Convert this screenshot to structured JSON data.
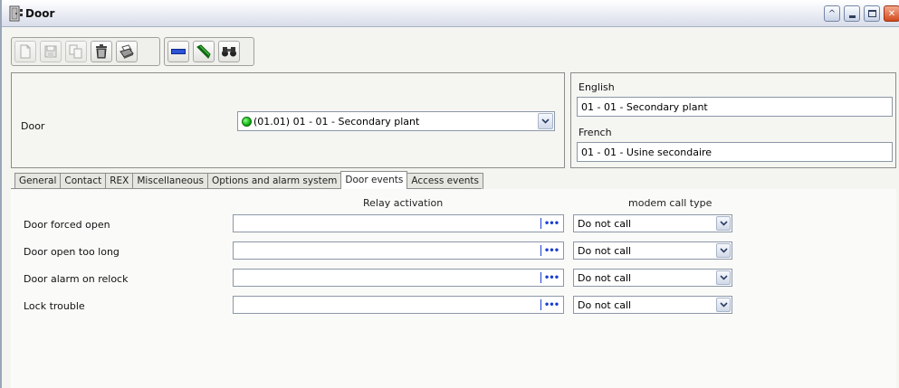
{
  "window": {
    "title": "Door",
    "controls": [
      "restore-up",
      "minimize",
      "maximize",
      "close"
    ]
  },
  "toolbar": {
    "buttons": [
      {
        "icon": "new-document-icon",
        "enabled": false
      },
      {
        "icon": "save-icon",
        "enabled": false
      },
      {
        "icon": "copy-icon",
        "enabled": false
      },
      {
        "icon": "trash-icon",
        "enabled": true
      },
      {
        "icon": "printer-icon",
        "enabled": true
      },
      {
        "icon": "minus-bar-icon",
        "enabled": true
      },
      {
        "icon": "pencil-link-icon",
        "enabled": true
      },
      {
        "icon": "binoculars-icon",
        "enabled": true
      }
    ]
  },
  "header": {
    "door_label": "Door",
    "door_value": "(01.01) 01 - 01 - Secondary plant",
    "status_color": "#11b311",
    "english_label": "English",
    "english_value": "01 - 01 - Secondary plant",
    "french_label": "French",
    "french_value": "01 - 01 - Usine secondaire"
  },
  "tabs": [
    {
      "label": "General",
      "active": false
    },
    {
      "label": "Contact",
      "active": false
    },
    {
      "label": "REX",
      "active": false
    },
    {
      "label": "Miscellaneous",
      "active": false
    },
    {
      "label": "Options and alarm system",
      "active": false
    },
    {
      "label": "Door events",
      "active": true
    },
    {
      "label": "Access events",
      "active": false
    }
  ],
  "door_events": {
    "relay_header": "Relay activation",
    "modem_header": "modem call type",
    "rows": [
      {
        "label": "Door forced open",
        "relay": "",
        "modem": "Do not call"
      },
      {
        "label": "Door open too long",
        "relay": "",
        "modem": "Do not call"
      },
      {
        "label": "Door alarm on relock",
        "relay": "",
        "modem": "Do not call"
      },
      {
        "label": "Lock trouble",
        "relay": "",
        "modem": "Do not call"
      }
    ],
    "browse_label": "•••"
  }
}
